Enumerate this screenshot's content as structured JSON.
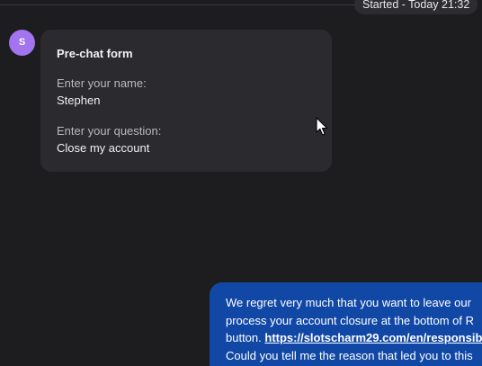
{
  "timeline": {
    "status_pill": "Started - Today 21:32"
  },
  "visitor": {
    "avatar_initial": "S",
    "avatar_color": "#a274f0"
  },
  "prechat_form": {
    "title": "Pre-chat form",
    "fields": [
      {
        "label": "Enter your name:",
        "value": "Stephen"
      },
      {
        "label": "Enter your question:",
        "value": "Close my account"
      }
    ]
  },
  "agent_message": {
    "bubble_color": "#1148a6",
    "line1": "We regret very much that you want to leave our",
    "line2": "process your account closure at the bottom of R",
    "line3_prefix": "button. ",
    "line3_link": "https://slotscharm29.com/en/responsib",
    "line4": "Could you tell me the reason that led you to this"
  },
  "colors": {
    "background": "#1d1d20",
    "card": "#2b2b2f",
    "pill": "#2d2d31"
  }
}
